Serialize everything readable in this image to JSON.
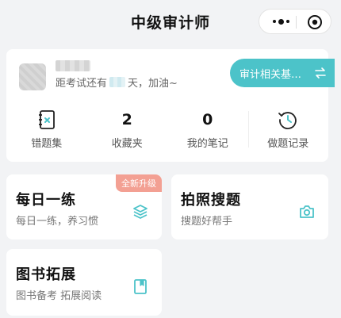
{
  "header": {
    "title": "中级审计师",
    "more_icon": "more-dots-icon",
    "close_icon": "target-circle-icon"
  },
  "profile": {
    "countdown_prefix": "距考试还有",
    "countdown_suffix": "天，加油~",
    "subject_button": "审计相关基…",
    "stats": [
      {
        "label": "错题集",
        "icon": "wrong-book-icon"
      },
      {
        "label": "收藏夹",
        "value": "2"
      },
      {
        "label": "我的笔记",
        "value": "0"
      },
      {
        "label": "做题记录",
        "icon": "history-clock-icon"
      }
    ]
  },
  "features": {
    "daily": {
      "title": "每日一练",
      "subtitle": "每日一练，养习惯",
      "badge": "全新升级",
      "icon": "layers-icon"
    },
    "photo": {
      "title": "拍照搜题",
      "subtitle": "搜题好帮手",
      "icon": "camera-icon"
    },
    "books": {
      "title": "图书拓展",
      "subtitle": "图书备考 拓展阅读",
      "icon": "book-icon"
    }
  },
  "colors": {
    "accent": "#4cc3c9",
    "badge": "#f3a093",
    "background": "#f2f3f5"
  }
}
